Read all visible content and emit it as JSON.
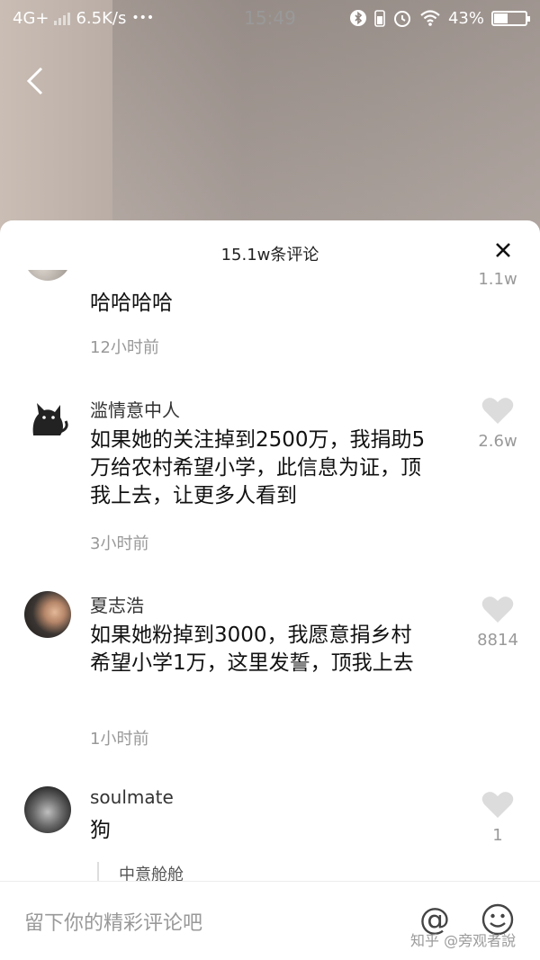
{
  "status_bar": {
    "network": "4G+",
    "speed": "6.5K/s",
    "dots": "•••",
    "time": "15:49",
    "battery": "43%",
    "battery_level": 0.43
  },
  "video": {
    "back_icon": "back-chevron-icon"
  },
  "sheet": {
    "title": "15.1w条评论",
    "close_icon": "close-icon"
  },
  "comments": [
    {
      "author": "",
      "text": "哈哈哈哈",
      "time": "12小时前",
      "likes": "1.1w"
    },
    {
      "author": "滥情意中人",
      "text": "如果她的关注掉到2500万，我捐助5万给农村希望小学，此信息为证，顶我上去，让更多人看到",
      "time": "3小时前",
      "likes": "2.6w"
    },
    {
      "author": "夏志浩",
      "text": "如果她粉掉到3000，我愿意捐乡村希望小学1万，这里发誓，顶我上去",
      "time": "1小时前",
      "likes": "8814"
    },
    {
      "author": "soulmate",
      "text": "狗",
      "time": "",
      "likes": "1",
      "reply_author": "中意舱舱"
    }
  ],
  "footer": {
    "input_placeholder": "留下你的精彩评论吧",
    "at_label": "@",
    "watermark": "知乎 @旁观者說"
  },
  "colors": {
    "accent": "#111111",
    "muted": "#999999",
    "heart": "#dcdcdc"
  }
}
